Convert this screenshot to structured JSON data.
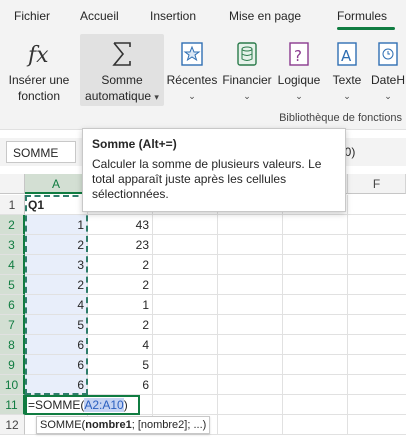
{
  "tabs": [
    {
      "label": "Fichier"
    },
    {
      "label": "Accueil"
    },
    {
      "label": "Insertion"
    },
    {
      "label": "Mise en page"
    },
    {
      "label": "Formules",
      "active": true
    }
  ],
  "ribbon": {
    "insert_function": {
      "line1": "Insérer une",
      "line2": "fonction",
      "icon": "fx-icon"
    },
    "autosum": {
      "line1": "Somme",
      "line2": "automatique",
      "icon": "sigma-icon"
    },
    "recent": {
      "label": "Récentes",
      "icon": "star-icon"
    },
    "financial": {
      "label": "Financier",
      "icon": "database-icon"
    },
    "logical": {
      "label": "Logique",
      "icon": "question-icon"
    },
    "text": {
      "label": "Texte",
      "icon": "text-icon"
    },
    "datetime": {
      "label": "DateH",
      "icon": "clock-icon"
    },
    "group_label": "Bibliothèque de fonctions"
  },
  "formula_bar": {
    "name_box": "SOMME",
    "formula_tail": "A10)"
  },
  "tooltip": {
    "title": "Somme (Alt+=)",
    "body": "Calculer la somme de plusieurs valeurs. Le total apparaît juste après les cellules sélectionnées."
  },
  "columns": [
    "A",
    "B",
    "C",
    "D",
    "E",
    "F"
  ],
  "rows": [
    {
      "num": "1",
      "a": "Q1",
      "b": ""
    },
    {
      "num": "2",
      "a": "1",
      "b": "43"
    },
    {
      "num": "3",
      "a": "2",
      "b": "23"
    },
    {
      "num": "4",
      "a": "3",
      "b": "2"
    },
    {
      "num": "5",
      "a": "2",
      "b": "2"
    },
    {
      "num": "6",
      "a": "4",
      "b": "1"
    },
    {
      "num": "7",
      "a": "5",
      "b": "2"
    },
    {
      "num": "8",
      "a": "6",
      "b": "4"
    },
    {
      "num": "9",
      "a": "6",
      "b": "5"
    },
    {
      "num": "10",
      "a": "6",
      "b": "6"
    },
    {
      "num": "11",
      "a": "",
      "b": ""
    },
    {
      "num": "12",
      "a": "",
      "b": ""
    }
  ],
  "active_cell": {
    "prefix": "=SOMME(",
    "ref": "A2:A10",
    "suffix": ")"
  },
  "function_hint": {
    "name": "SOMME(",
    "arg1": "nombre1",
    "rest": "; [nombre2]; ...)"
  },
  "colors": {
    "accent": "#107c41",
    "selection": "#e8eefa",
    "reference": "#2b5fbf"
  }
}
